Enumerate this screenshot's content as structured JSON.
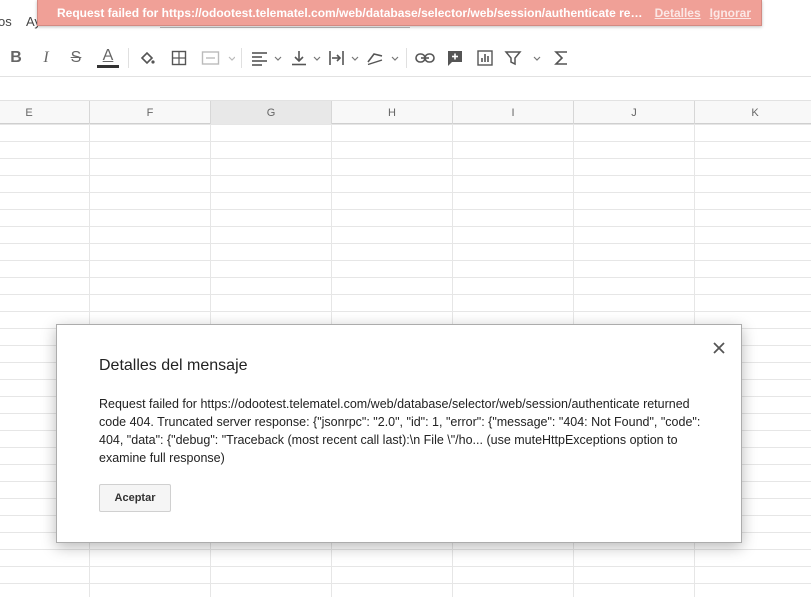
{
  "menu": {
    "item_partial_1": "os",
    "item_partial_2": "Ay"
  },
  "notification": {
    "message": "Request failed for https://odootest.telematel.com/web/database/selector/web/session/authenticate returned co...",
    "details_link": "Detalles",
    "ignore_link": "Ignorar",
    "colors": {
      "background": "#f0a097",
      "text": "#ffffff"
    }
  },
  "toolbar": {
    "buttons": [
      {
        "name": "bold-icon",
        "glyph": "B"
      },
      {
        "name": "italic-icon",
        "glyph": "I"
      },
      {
        "name": "strikethrough-icon",
        "glyph": "S"
      },
      {
        "name": "text-color-icon",
        "glyph": "A"
      },
      {
        "name": "fill-color-icon"
      },
      {
        "name": "borders-icon"
      },
      {
        "name": "merge-cells-icon"
      },
      {
        "name": "horizontal-align-icon"
      },
      {
        "name": "vertical-align-icon"
      },
      {
        "name": "text-wrapping-icon"
      },
      {
        "name": "text-rotation-icon"
      },
      {
        "name": "insert-link-icon"
      },
      {
        "name": "insert-comment-icon"
      },
      {
        "name": "insert-chart-icon"
      },
      {
        "name": "filter-icon"
      },
      {
        "name": "functions-icon"
      }
    ]
  },
  "grid": {
    "columns": [
      "E",
      "F",
      "G",
      "H",
      "I",
      "J",
      "K"
    ],
    "selected_column": "G"
  },
  "dialog": {
    "title": "Detalles del mensaje",
    "body": "Request failed for https://odootest.telematel.com/web/database/selector/web/session/authenticate returned code 404. Truncated server response: {\"jsonrpc\": \"2.0\", \"id\": 1, \"error\": {\"message\": \"404: Not Found\", \"code\": 404, \"data\": {\"debug\": \"Traceback (most recent call last):\\n File \\\"/ho... (use muteHttpExceptions option to examine full response)",
    "accept_button": "Aceptar",
    "close_icon": "close-icon"
  }
}
